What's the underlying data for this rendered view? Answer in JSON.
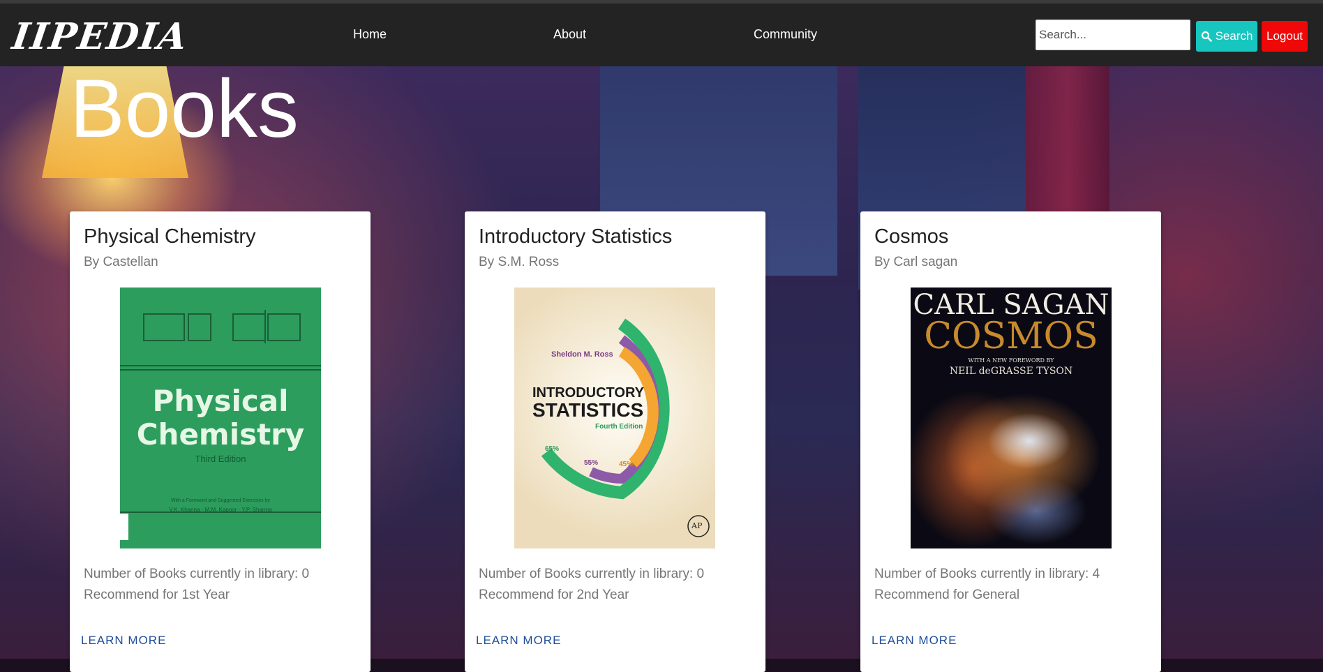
{
  "nav": {
    "brand": "IIPEDIA",
    "links": [
      "Home",
      "About",
      "Community"
    ],
    "search_placeholder": "Search...",
    "search_label": "Search",
    "logout_label": "Logout"
  },
  "hero": {
    "title": "Books"
  },
  "books": [
    {
      "title": "Physical Chemistry",
      "author": "By Castellan",
      "stock": "Number of Books currently in library: 0",
      "recommend": "Recommend for 1st Year",
      "cta": "LEARN MORE",
      "cover": {
        "title_line1": "Physical",
        "title_line2": "Chemistry",
        "edition": "Third Edition",
        "foreword": "With a Foreword and Suggested Exercises by",
        "names": "V.K. Khanna · M.M. Kapoor · Y.P. Sharma"
      }
    },
    {
      "title": "Introductory Statistics",
      "author": "By S.M. Ross",
      "stock": "Number of Books currently in library: 0",
      "recommend": "Recommend for 2nd Year",
      "cta": "LEARN MORE",
      "cover": {
        "author": "Sheldon M. Ross",
        "title_line1": "INTRODUCTORY",
        "title_line2": "STATISTICS",
        "edition": "Fourth Edition",
        "p65": "65%",
        "p55": "55%",
        "p45": "45%",
        "publisher": "AP"
      }
    },
    {
      "title": "Cosmos",
      "author": "By Carl sagan",
      "stock": "Number of Books currently in library: 4",
      "recommend": "Recommend for General",
      "cta": "LEARN MORE",
      "cover": {
        "author": "CARL SAGAN",
        "title": "COSMOS",
        "foreword": "WITH A NEW FOREWORD BY",
        "foreword_by": "NEIL deGRASSE TYSON"
      }
    }
  ]
}
